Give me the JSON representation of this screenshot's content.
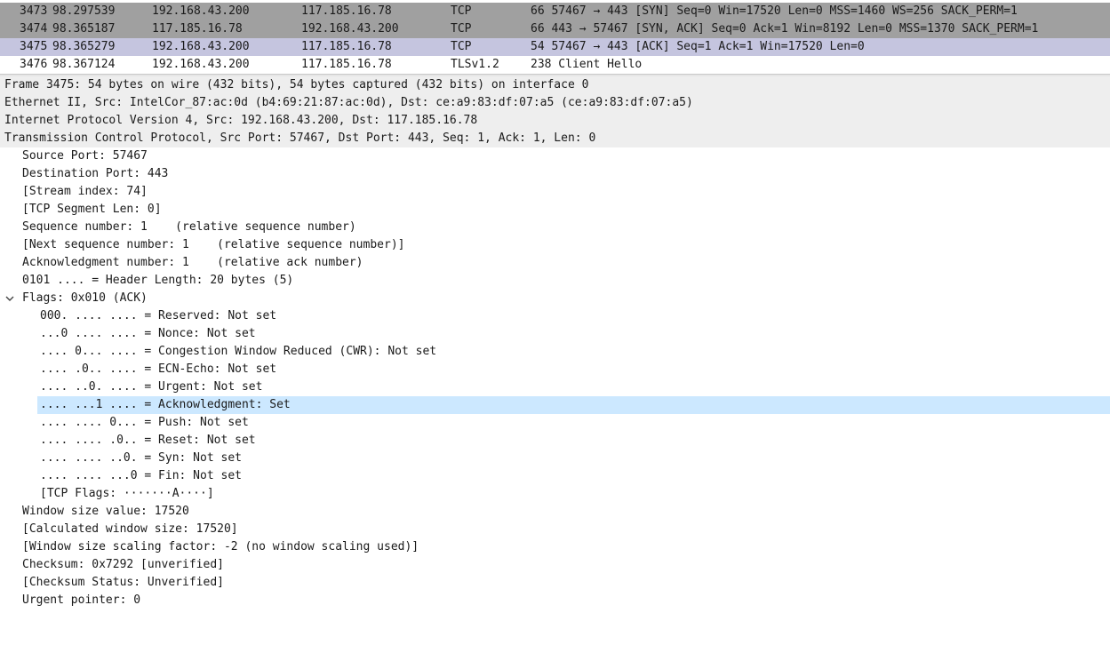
{
  "packet_list": {
    "rows": [
      {
        "no": "3473",
        "time": "98.297539",
        "src": "192.168.43.200",
        "dst": "117.185.16.78",
        "proto": "TCP",
        "info": "66 57467 → 443 [SYN] Seq=0 Win=17520 Len=0 MSS=1460 WS=256 SACK_PERM=1"
      },
      {
        "no": "3474",
        "time": "98.365187",
        "src": "117.185.16.78",
        "dst": "192.168.43.200",
        "proto": "TCP",
        "info": "66 443 → 57467 [SYN, ACK] Seq=0 Ack=1 Win=8192 Len=0 MSS=1370 SACK_PERM=1"
      },
      {
        "no": "3475",
        "time": "98.365279",
        "src": "192.168.43.200",
        "dst": "117.185.16.78",
        "proto": "TCP",
        "info": "54 57467 → 443 [ACK] Seq=1 Ack=1 Win=17520 Len=0"
      },
      {
        "no": "3476",
        "time": "98.367124",
        "src": "192.168.43.200",
        "dst": "117.185.16.78",
        "proto": "TLSv1.2",
        "info": "238 Client Hello"
      }
    ]
  },
  "details": {
    "headers": [
      "Frame 3475: 54 bytes on wire (432 bits), 54 bytes captured (432 bits) on interface 0",
      "Ethernet II, Src: IntelCor_87:ac:0d (b4:69:21:87:ac:0d), Dst: ce:a9:83:df:07:a5 (ce:a9:83:df:07:a5)",
      "Internet Protocol Version 4, Src: 192.168.43.200, Dst: 117.185.16.78",
      "Transmission Control Protocol, Src Port: 57467, Dst Port: 443, Seq: 1, Ack: 1, Len: 0"
    ],
    "tcp_fields_a": [
      "Source Port: 57467",
      "Destination Port: 443",
      "[Stream index: 74]",
      "[TCP Segment Len: 0]",
      "Sequence number: 1    (relative sequence number)",
      "[Next sequence number: 1    (relative sequence number)]",
      "Acknowledgment number: 1    (relative ack number)",
      "0101 .... = Header Length: 20 bytes (5)"
    ],
    "flags_label": "Flags: 0x010 (ACK)",
    "flag_items": [
      "000. .... .... = Reserved: Not set",
      "...0 .... .... = Nonce: Not set",
      ".... 0... .... = Congestion Window Reduced (CWR): Not set",
      ".... .0.. .... = ECN-Echo: Not set",
      ".... ..0. .... = Urgent: Not set",
      ".... ...1 .... = Acknowledgment: Set",
      ".... .... 0... = Push: Not set",
      ".... .... .0.. = Reset: Not set",
      ".... .... ..0. = Syn: Not set",
      ".... .... ...0 = Fin: Not set",
      "[TCP Flags: ·······A····]"
    ],
    "tcp_fields_b": [
      "Window size value: 17520",
      "[Calculated window size: 17520]",
      "[Window size scaling factor: -2 (no window scaling used)]",
      "Checksum: 0x7292 [unverified]",
      "[Checksum Status: Unverified]",
      "Urgent pointer: 0"
    ]
  },
  "colors": {
    "row_gray": "#a0a0a0",
    "row_selected": "#c5c5df",
    "header_band": "#eeeeee",
    "highlight": "#cce8ff"
  }
}
